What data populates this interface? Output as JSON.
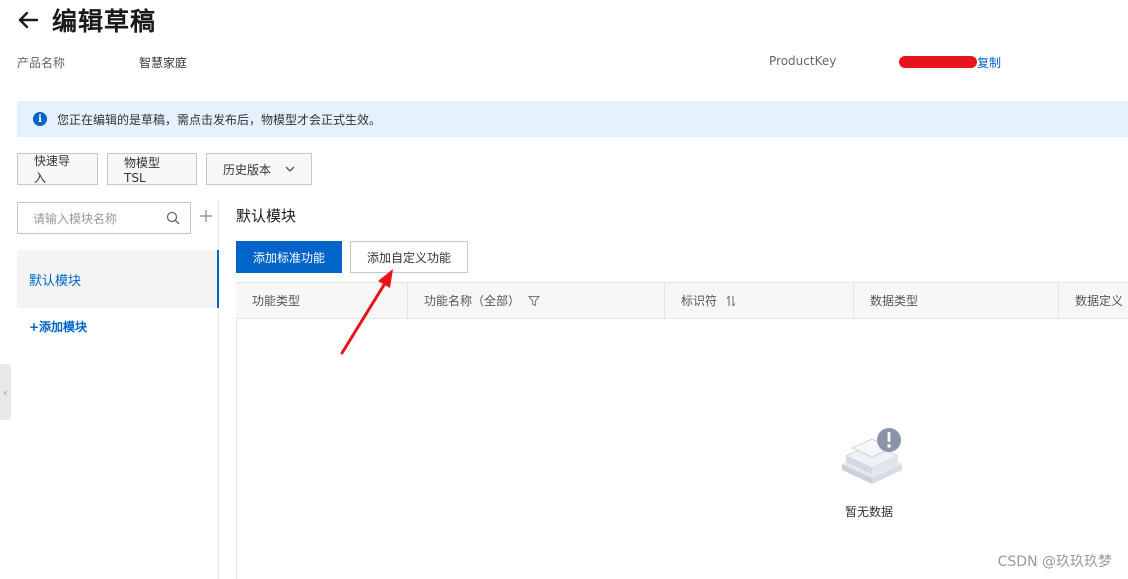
{
  "header": {
    "title": "编辑草稿",
    "back_icon": "arrow-left-icon"
  },
  "meta": {
    "product_name_label": "产品名称",
    "product_name_value": "智慧家庭",
    "product_key_label": "ProductKey",
    "copy_label": "复制"
  },
  "alert": {
    "icon": "info-icon",
    "text": "您正在编辑的是草稿，需点击发布后，物模型才会正式生效。"
  },
  "toolbar": {
    "quick_import": "快速导入",
    "tsl": "物模型 TSL",
    "history": "历史版本"
  },
  "sidebar": {
    "search_placeholder": "请输入模块名称",
    "items": [
      {
        "label": "默认模块"
      }
    ],
    "add_module": "+添加模块"
  },
  "main": {
    "section_title": "默认模块",
    "add_standard": "添加标准功能",
    "add_custom": "添加自定义功能",
    "columns": [
      {
        "label": "功能类型"
      },
      {
        "label": "功能名称（全部）"
      },
      {
        "label": "标识符"
      },
      {
        "label": "数据类型"
      },
      {
        "label": "数据定义"
      }
    ],
    "empty_text": "暂无数据"
  },
  "watermark": "CSDN @玖玖玖梦",
  "colors": {
    "primary": "#0064c8",
    "alert_bg": "#e5f1fc",
    "annotation_arrow": "#e8141c"
  }
}
